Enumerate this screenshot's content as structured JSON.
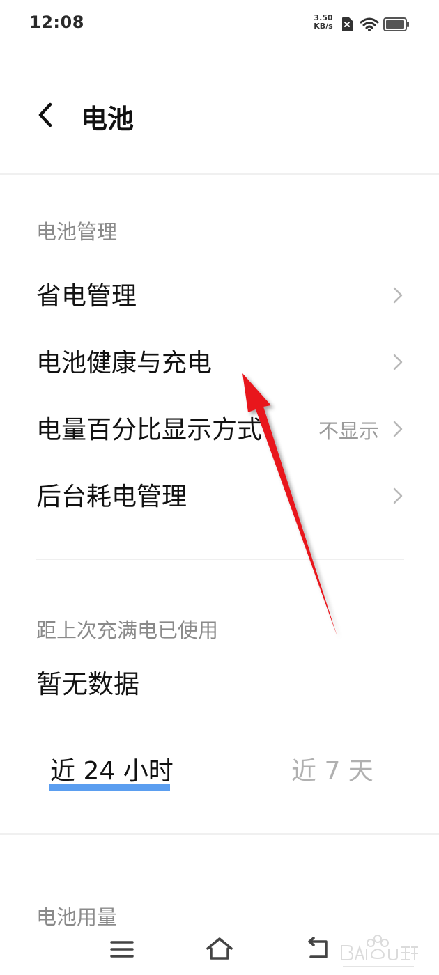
{
  "status_bar": {
    "time": "12:08",
    "net_speed_value": "3.50",
    "net_speed_unit": "KB/s",
    "icons": [
      "sim-x-icon",
      "wifi-icon",
      "battery-icon"
    ]
  },
  "header": {
    "title": "电池",
    "back_icon": "chevron-left-icon"
  },
  "sections": {
    "battery_management": {
      "label": "电池管理",
      "items": [
        {
          "title": "省电管理",
          "value": ""
        },
        {
          "title": "电池健康与充电",
          "value": ""
        },
        {
          "title": "电量百分比显示方式",
          "value": "不显示"
        },
        {
          "title": "后台耗电管理",
          "value": ""
        }
      ]
    },
    "usage_since_full": {
      "label": "距上次充满电已使用",
      "value": "暂无数据"
    },
    "tabs": [
      {
        "label": "近 24 小时",
        "active": true
      },
      {
        "label": "近 7 天",
        "active": false
      }
    ],
    "battery_usage": {
      "label": "电池用量"
    }
  },
  "nav_bar": {
    "icons": [
      "menu-icon",
      "home-icon",
      "back-icon"
    ]
  },
  "colors": {
    "accent": "#5b9ef0",
    "annotation_arrow": "#e8141b",
    "secondary_text": "#8a8a8a"
  }
}
